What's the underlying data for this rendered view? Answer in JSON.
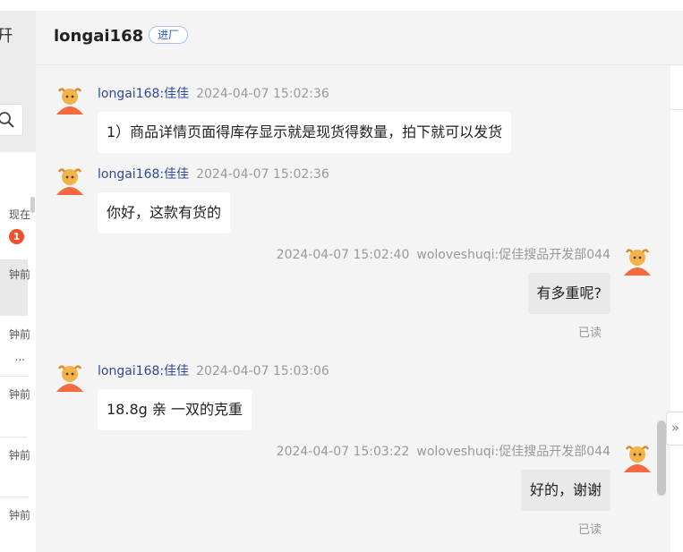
{
  "sidebar": {
    "title_fragment": "幵",
    "badge_count": "1",
    "items": [
      {
        "time": "现在"
      },
      {
        "time": "钟前"
      },
      {
        "time": "钟前",
        "more": "..."
      },
      {
        "time": "钟前"
      },
      {
        "time": "钟前"
      },
      {
        "time": "钟前"
      }
    ]
  },
  "chat": {
    "title": "longai168",
    "tag": "进厂",
    "messages": [
      {
        "dir": "in",
        "sender": "longai168:佳佳",
        "time": "2024-04-07 15:02:36",
        "text": "1）商品详情页面得库存显示就是现货得数量，拍下就可以发货"
      },
      {
        "dir": "in",
        "sender": "longai168:佳佳",
        "time": "2024-04-07 15:02:36",
        "text": "你好，这款有货的"
      },
      {
        "dir": "out",
        "sender": "woloveshuqi:促佳搜品开发部044",
        "time": "2024-04-07 15:02:40",
        "text": "有多重呢?",
        "status": "已读"
      },
      {
        "dir": "in",
        "sender": "longai168:佳佳",
        "time": "2024-04-07 15:03:06",
        "text": "18.8g 亲 一双的克重"
      },
      {
        "dir": "out",
        "sender": "woloveshuqi:促佳搜品开发部044",
        "time": "2024-04-07 15:03:22",
        "text": "好的，谢谢",
        "status": "已读"
      }
    ]
  },
  "ui": {
    "expand_glyph": "»",
    "accent": "#2e4a9c",
    "badge_color": "#f0502e"
  }
}
